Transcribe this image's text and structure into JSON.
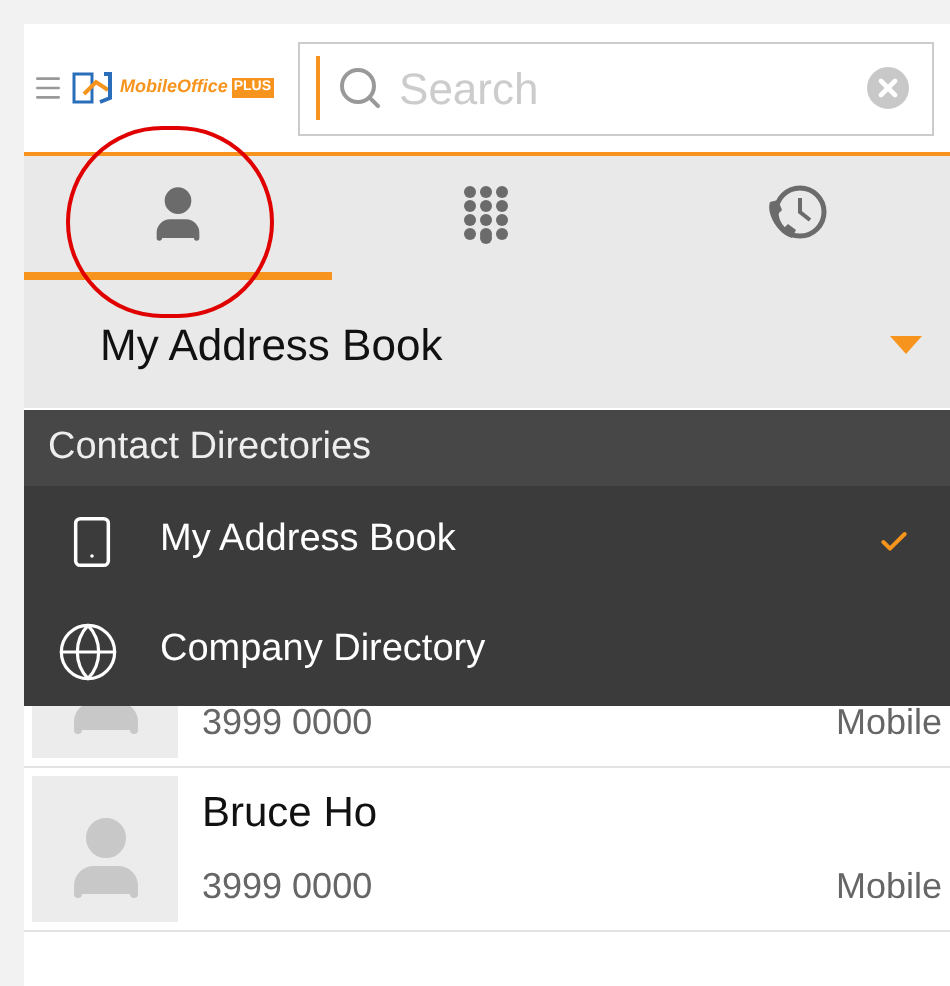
{
  "header": {
    "logo_text": "MobileOffice",
    "logo_badge": "PLUS",
    "search": {
      "placeholder": "Search"
    }
  },
  "tabs": [
    {
      "kind": "contacts",
      "selected": true
    },
    {
      "kind": "dialpad",
      "selected": false
    },
    {
      "kind": "history",
      "selected": false
    }
  ],
  "directory_picker": {
    "value": "My Address Book",
    "expanded": true
  },
  "directory_menu": {
    "title": "Contact Directories",
    "items": [
      {
        "kind": "phone",
        "label": "My Address Book",
        "selected": true
      },
      {
        "kind": "globe",
        "label": "Company Directory",
        "selected": false
      }
    ]
  },
  "contacts": [
    {
      "number": "3999 0000",
      "type": "Mobile"
    },
    {
      "name": "Bruce Ho",
      "number": "3999 0000",
      "type": "Mobile"
    }
  ]
}
